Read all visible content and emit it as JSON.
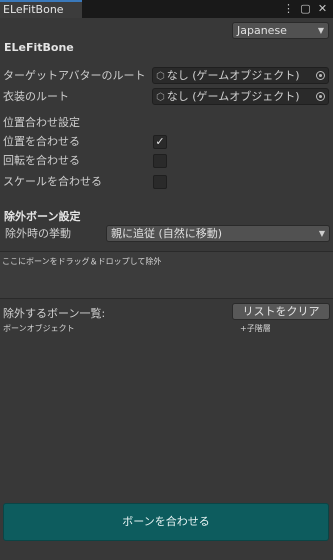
{
  "tab": {
    "title": "ELeFitBone"
  },
  "tab_icons": {
    "menu": "⋮",
    "maximize": "▢",
    "close": "✕"
  },
  "language": {
    "selected": "Japanese",
    "arrow": "▼"
  },
  "header": {
    "title": "ELeFitBone"
  },
  "target_avatar": {
    "label": "ターゲットアバターのルート",
    "value": "なし (ゲームオブジェクト)",
    "icon": "⬡"
  },
  "costume_root": {
    "label": "衣装のルート",
    "value": "なし (ゲームオブジェクト)",
    "icon": "⬡"
  },
  "alignment": {
    "heading": "位置合わせ設定",
    "position": {
      "label": "位置を合わせる",
      "checked": true,
      "mark": "✓"
    },
    "rotation": {
      "label": "回転を合わせる",
      "checked": false
    },
    "scale": {
      "label": "スケールを合わせる",
      "checked": false
    }
  },
  "exclude": {
    "heading": "除外ボーン設定",
    "behavior_label": "除外時の挙動",
    "behavior_value": "親に追従 (自然に移動)",
    "arrow": "▼",
    "drop_hint": "ここにボーンをドラッグ＆ドロップして除外",
    "list_label": "除外するボーン一覧:",
    "clear_button": "リストをクリア",
    "col_bone": "ボーンオブジェクト",
    "col_children": "+子階層"
  },
  "actions": {
    "match_button": "ボーンを合わせる"
  }
}
